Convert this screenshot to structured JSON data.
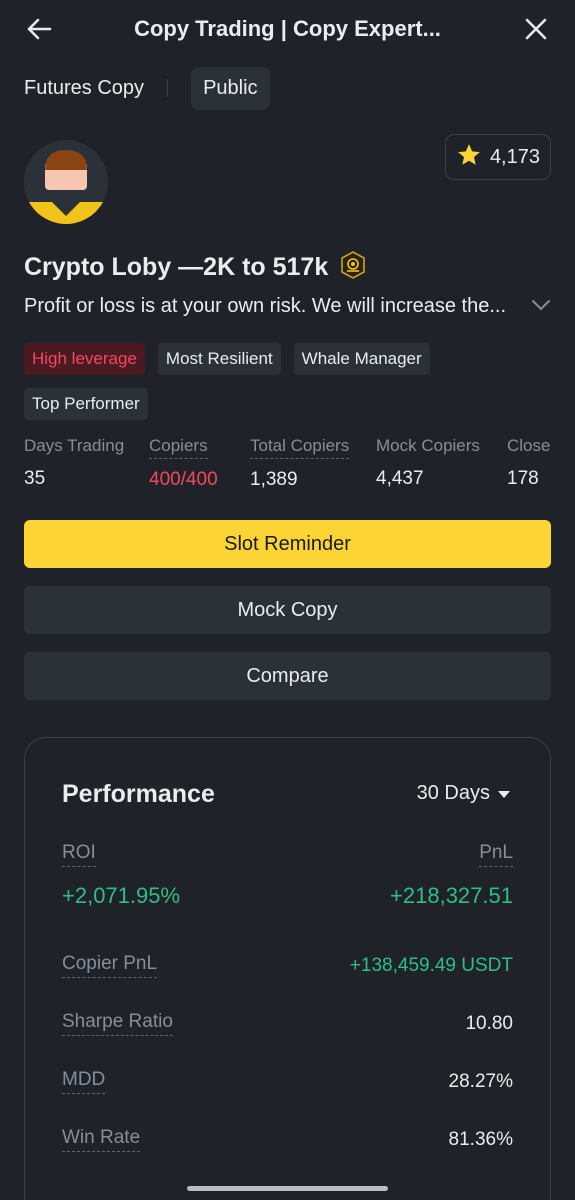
{
  "header": {
    "title": "Copy Trading | Copy Expert..."
  },
  "tabs": {
    "futures": "Futures Copy",
    "public": "Public"
  },
  "favorites": {
    "count": "4,173"
  },
  "profile": {
    "name": "Crypto Loby —2K to 517k",
    "description": "Profit or loss is at your own risk. We will increase the..."
  },
  "tags": [
    "High leverage",
    "Most Resilient",
    "Whale Manager",
    "Top Performer"
  ],
  "stats": [
    {
      "label": "Days Trading",
      "value": "35"
    },
    {
      "label": "Copiers",
      "value": "400/400"
    },
    {
      "label": "Total Copiers",
      "value": "1,389"
    },
    {
      "label": "Mock Copiers",
      "value": "4,437"
    },
    {
      "label": "Close",
      "value": "178"
    }
  ],
  "buttons": {
    "slot_reminder": "Slot Reminder",
    "mock_copy": "Mock Copy",
    "compare": "Compare"
  },
  "performance": {
    "title": "Performance",
    "period": "30 Days",
    "roi_label": "ROI",
    "roi_value": "+2,071.95%",
    "pnl_label": "PnL",
    "pnl_value": "+218,327.51",
    "rows": [
      {
        "label": "Copier PnL",
        "value": "+138,459.49 USDT"
      },
      {
        "label": "Sharpe Ratio",
        "value": "10.80"
      },
      {
        "label": "MDD",
        "value": "28.27%"
      },
      {
        "label": "Win Rate",
        "value": "81.36%"
      }
    ]
  },
  "colors": {
    "accent": "#fcd535",
    "positive": "#2ebd85",
    "negative": "#f6465d",
    "background": "#1f2329"
  }
}
